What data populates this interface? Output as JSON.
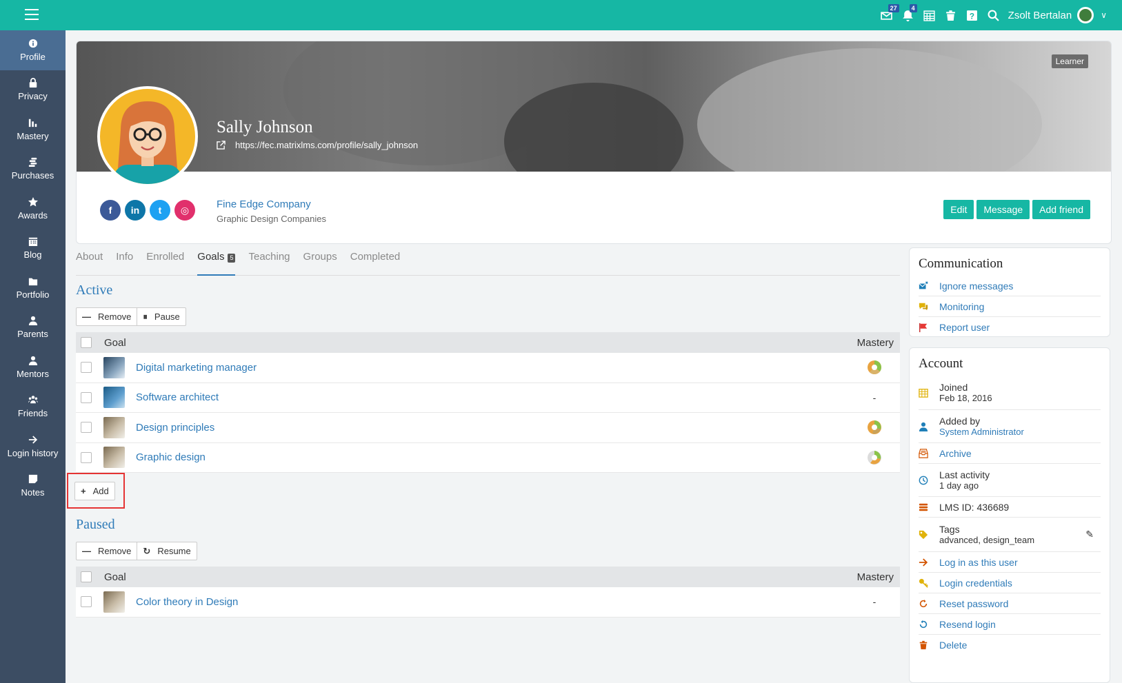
{
  "topbar": {
    "notifications": [
      {
        "icon": "inbox-icon",
        "badge": "27"
      },
      {
        "icon": "bell-icon",
        "badge": "4"
      },
      {
        "icon": "calendar-icon",
        "badge": ""
      },
      {
        "icon": "trash-icon",
        "badge": ""
      },
      {
        "icon": "help-icon",
        "badge": ""
      },
      {
        "icon": "search-icon",
        "badge": ""
      }
    ],
    "user_name": "Zsolt Bertalan"
  },
  "sidebar": {
    "items": [
      {
        "label": "Profile",
        "icon": "info-icon",
        "active": true
      },
      {
        "label": "Privacy",
        "icon": "lock-icon"
      },
      {
        "label": "Mastery",
        "icon": "bar-chart-icon"
      },
      {
        "label": "Purchases",
        "icon": "coins-icon"
      },
      {
        "label": "Awards",
        "icon": "star-icon"
      },
      {
        "label": "Blog",
        "icon": "calendar-icon"
      },
      {
        "label": "Portfolio",
        "icon": "folder-icon"
      },
      {
        "label": "Parents",
        "icon": "person-icon"
      },
      {
        "label": "Mentors",
        "icon": "person-icon"
      },
      {
        "label": "Friends",
        "icon": "group-icon"
      },
      {
        "label": "Login history",
        "icon": "arrow-right-icon"
      },
      {
        "label": "Notes",
        "icon": "note-icon"
      }
    ]
  },
  "profile": {
    "role_badge": "Learner",
    "name": "Sally Johnson",
    "url": "https://fec.matrixlms.com/profile/sally_johnson",
    "company": "Fine Edge Company",
    "company_category": "Graphic Design Companies",
    "socials": [
      {
        "icon": "facebook-icon",
        "glyph": "f",
        "color": "#3b5998"
      },
      {
        "icon": "linkedin-icon",
        "glyph": "in",
        "color": "#0e76a8"
      },
      {
        "icon": "twitter-icon",
        "glyph": "t",
        "color": "#1da1f2"
      },
      {
        "icon": "instagram-icon",
        "glyph": "◎",
        "color": "#e1306c"
      }
    ],
    "actions": {
      "edit": "Edit",
      "message": "Message",
      "add_friend": "Add friend"
    }
  },
  "tabs": [
    {
      "label": "About"
    },
    {
      "label": "Info"
    },
    {
      "label": "Enrolled"
    },
    {
      "label": "Goals",
      "count": "5",
      "active": true
    },
    {
      "label": "Teaching"
    },
    {
      "label": "Groups"
    },
    {
      "label": "Completed"
    }
  ],
  "active_section": {
    "title": "Active",
    "remove_label": "Remove",
    "pause_label": "Pause",
    "col_goal": "Goal",
    "col_mastery": "Mastery",
    "rows": [
      {
        "name": "Digital marketing manager",
        "mastery": "pie"
      },
      {
        "name": "Software architect",
        "mastery": "-"
      },
      {
        "name": "Design principles",
        "mastery": "pie"
      },
      {
        "name": "Graphic design",
        "mastery": "pie"
      }
    ],
    "add_label": "Add"
  },
  "paused_section": {
    "title": "Paused",
    "remove_label": "Remove",
    "resume_label": "Resume",
    "col_goal": "Goal",
    "col_mastery": "Mastery",
    "rows": [
      {
        "name": "Color theory in Design",
        "mastery": "-"
      }
    ]
  },
  "communication": {
    "title": "Communication",
    "items": [
      {
        "label": "Ignore messages",
        "icon": "ignore-mail-icon"
      },
      {
        "label": "Monitoring",
        "icon": "chat-icon"
      },
      {
        "label": "Report user",
        "icon": "flag-icon"
      }
    ]
  },
  "account": {
    "title": "Account",
    "joined_label": "Joined",
    "joined_value": "Feb 18, 2016",
    "added_by_label": "Added by",
    "added_by_value": "System Administrator",
    "archive": "Archive",
    "last_activity_label": "Last activity",
    "last_activity_value": "1 day ago",
    "lms_id": "LMS ID: 436689",
    "tags_label": "Tags",
    "tags_value": "advanced, design_team",
    "log_in_as": "Log in as this user",
    "login_credentials": "Login credentials",
    "reset_password": "Reset password",
    "resend_login": "Resend login",
    "delete": "Delete"
  },
  "colors": {
    "accent": "#16b7a4",
    "sidebar": "#3c4d63",
    "link": "#2f7bb8"
  }
}
